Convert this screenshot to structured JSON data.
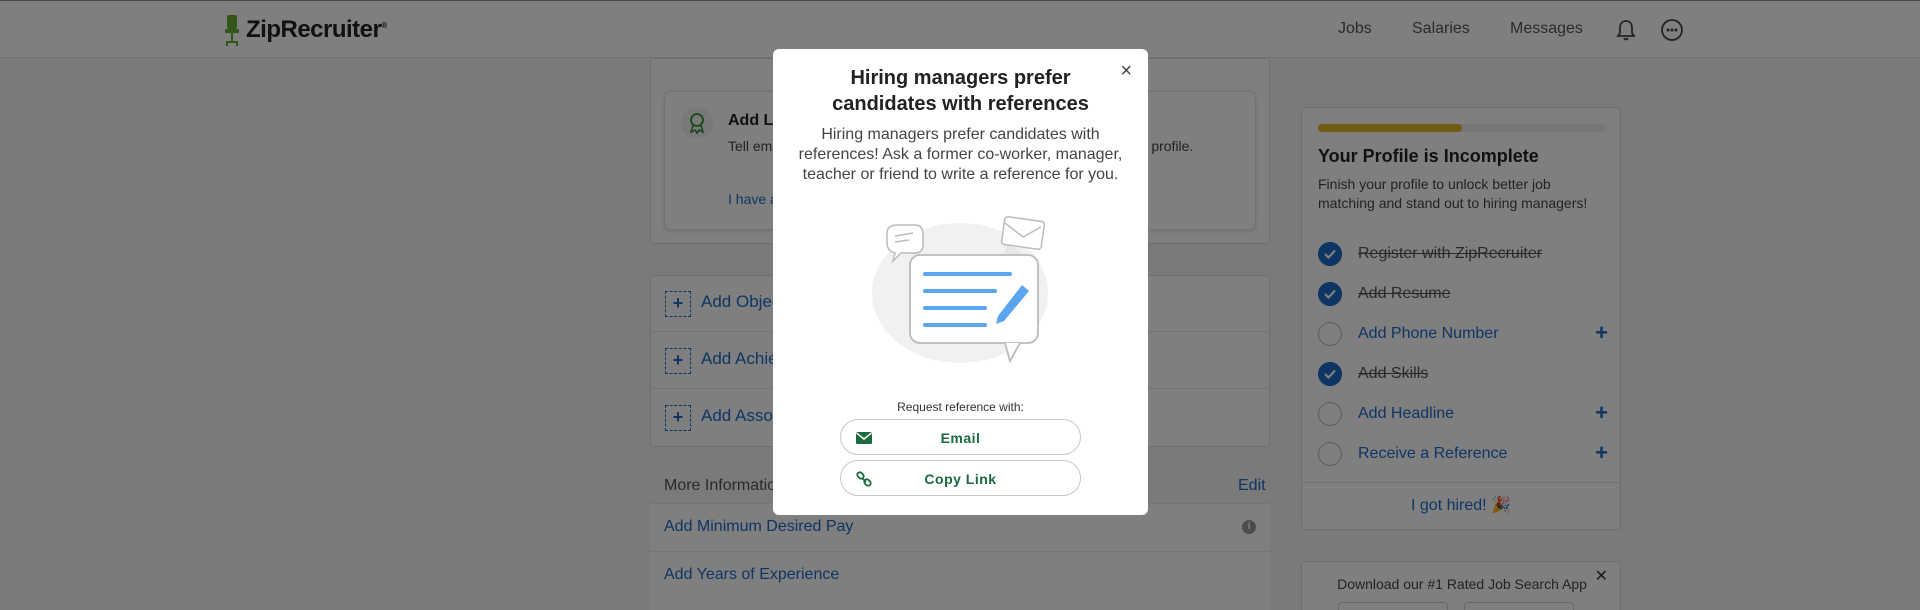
{
  "header": {
    "logo_text": "ZipRecruiter",
    "logo_reg": "®",
    "nav": [
      "Jobs",
      "Salaries",
      "Messages"
    ],
    "icons": [
      "bell-icon",
      "more-options-icon"
    ]
  },
  "license_card": {
    "title": "Add License",
    "description": "Tell employers about any professional license or certification to your profile.",
    "link": "I have a license"
  },
  "add_section": {
    "items": [
      "Add Objective",
      "Add Achievement",
      "Add Association"
    ]
  },
  "more_info": {
    "title": "More Information",
    "edit": "Edit",
    "rows": [
      "Add Minimum Desired Pay",
      "Add Years of Experience"
    ]
  },
  "profile": {
    "progress_percent": 50,
    "title": "Your Profile is Incomplete",
    "description": "Finish your profile to unlock better job matching and stand out to hiring managers!",
    "steps": [
      {
        "label": "Register with ZipRecruiter",
        "done": true
      },
      {
        "label": "Add Resume",
        "done": true
      },
      {
        "label": "Add Phone Number",
        "done": false
      },
      {
        "label": "Add Skills",
        "done": true
      },
      {
        "label": "Add Headline",
        "done": false
      },
      {
        "label": "Receive a Reference",
        "done": false
      }
    ],
    "got_hired": "I got hired! 🎉"
  },
  "app_promo": {
    "text": "Download our #1 Rated Job Search App",
    "close": "✕"
  },
  "modal": {
    "close": "×",
    "title": "Hiring managers prefer candidates with references",
    "description": "Hiring managers prefer candidates with references! Ask a former co-worker, manager, teacher or friend to write a reference for you.",
    "request_label": "Request reference with:",
    "email_button": "Email",
    "copy_link_button": "Copy Link"
  },
  "colors": {
    "brand_green": "#6aa92f",
    "link_blue": "#1d6ac9",
    "progress_yellow": "#e2b623",
    "button_text_green": "#1a6a3e"
  }
}
